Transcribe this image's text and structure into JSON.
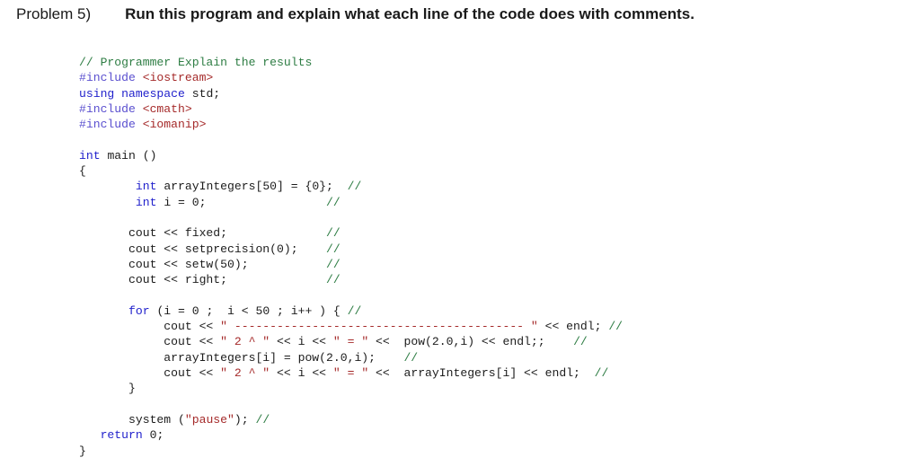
{
  "header": {
    "label": "Problem 5)",
    "text": "Run this program and explain what each line of the code does with comments."
  },
  "colors": {
    "background": "#ffffff",
    "plain": "#1c1c1c",
    "comment": "#2e7d44",
    "keyword": "#2222cc",
    "preprocessor": "#5a4fcf",
    "string": "#a52a2a",
    "header_name": "#a52a2a"
  },
  "code": {
    "language": "C++",
    "lines": [
      {
        "tokens": [
          {
            "t": "// Programmer Explain the results",
            "c": "comment"
          }
        ]
      },
      {
        "tokens": [
          {
            "t": "#include ",
            "c": "pre"
          },
          {
            "t": "<iostream>",
            "c": "header"
          }
        ]
      },
      {
        "tokens": [
          {
            "t": "using namespace ",
            "c": "keyword"
          },
          {
            "t": "std;",
            "c": "plain"
          }
        ]
      },
      {
        "tokens": [
          {
            "t": "#include ",
            "c": "pre"
          },
          {
            "t": "<cmath>",
            "c": "header"
          }
        ]
      },
      {
        "tokens": [
          {
            "t": "#include ",
            "c": "pre"
          },
          {
            "t": "<iomanip>",
            "c": "header"
          }
        ]
      },
      {
        "tokens": []
      },
      {
        "tokens": [
          {
            "t": "int ",
            "c": "keyword"
          },
          {
            "t": "main ()",
            "c": "plain"
          }
        ]
      },
      {
        "tokens": [
          {
            "t": "{",
            "c": "plain"
          }
        ]
      },
      {
        "tokens": [
          {
            "t": "        ",
            "c": "plain"
          },
          {
            "t": "int ",
            "c": "keyword"
          },
          {
            "t": "arrayIntegers[50] = {0};  ",
            "c": "plain"
          },
          {
            "t": "//",
            "c": "comment"
          }
        ]
      },
      {
        "tokens": [
          {
            "t": "        ",
            "c": "plain"
          },
          {
            "t": "int ",
            "c": "keyword"
          },
          {
            "t": "i = 0;",
            "c": "plain"
          },
          {
            "t": "                 ",
            "c": "plain"
          },
          {
            "t": "//",
            "c": "comment"
          }
        ]
      },
      {
        "tokens": []
      },
      {
        "tokens": [
          {
            "t": "       cout << fixed;",
            "c": "plain"
          },
          {
            "t": "              ",
            "c": "plain"
          },
          {
            "t": "//",
            "c": "comment"
          }
        ]
      },
      {
        "tokens": [
          {
            "t": "       cout << setprecision(0);",
            "c": "plain"
          },
          {
            "t": "    ",
            "c": "plain"
          },
          {
            "t": "//",
            "c": "comment"
          }
        ]
      },
      {
        "tokens": [
          {
            "t": "       cout << setw(50);",
            "c": "plain"
          },
          {
            "t": "           ",
            "c": "plain"
          },
          {
            "t": "//",
            "c": "comment"
          }
        ]
      },
      {
        "tokens": [
          {
            "t": "       cout << right;",
            "c": "plain"
          },
          {
            "t": "              ",
            "c": "plain"
          },
          {
            "t": "//",
            "c": "comment"
          }
        ]
      },
      {
        "tokens": []
      },
      {
        "tokens": [
          {
            "t": "       ",
            "c": "plain"
          },
          {
            "t": "for ",
            "c": "keyword"
          },
          {
            "t": "(i = 0 ;  i < 50 ; i++ ) { ",
            "c": "plain"
          },
          {
            "t": "//",
            "c": "comment"
          }
        ]
      },
      {
        "tokens": [
          {
            "t": "            cout << ",
            "c": "plain"
          },
          {
            "t": "\" ----------------------------------------- \"",
            "c": "string"
          },
          {
            "t": " << endl; ",
            "c": "plain"
          },
          {
            "t": "//",
            "c": "comment"
          }
        ]
      },
      {
        "tokens": [
          {
            "t": "            cout << ",
            "c": "plain"
          },
          {
            "t": "\" 2 ^ \"",
            "c": "string"
          },
          {
            "t": " << i << ",
            "c": "plain"
          },
          {
            "t": "\" = \"",
            "c": "string"
          },
          {
            "t": " <<  pow(2.0,i) << endl;;    ",
            "c": "plain"
          },
          {
            "t": "//",
            "c": "comment"
          }
        ]
      },
      {
        "tokens": [
          {
            "t": "            arrayIntegers[i] = pow(2.0,i);    ",
            "c": "plain"
          },
          {
            "t": "//",
            "c": "comment"
          }
        ]
      },
      {
        "tokens": [
          {
            "t": "            cout << ",
            "c": "plain"
          },
          {
            "t": "\" 2 ^ \"",
            "c": "string"
          },
          {
            "t": " << i << ",
            "c": "plain"
          },
          {
            "t": "\" = \"",
            "c": "string"
          },
          {
            "t": " <<  arrayIntegers[i] << endl;  ",
            "c": "plain"
          },
          {
            "t": "//",
            "c": "comment"
          }
        ]
      },
      {
        "tokens": [
          {
            "t": "       }",
            "c": "plain"
          }
        ]
      },
      {
        "tokens": []
      },
      {
        "tokens": [
          {
            "t": "       system (",
            "c": "plain"
          },
          {
            "t": "\"pause\"",
            "c": "string"
          },
          {
            "t": "); ",
            "c": "plain"
          },
          {
            "t": "//",
            "c": "comment"
          }
        ]
      },
      {
        "tokens": [
          {
            "t": "   ",
            "c": "plain"
          },
          {
            "t": "return ",
            "c": "keyword"
          },
          {
            "t": "0;",
            "c": "plain"
          }
        ]
      },
      {
        "tokens": [
          {
            "t": "}",
            "c": "plain"
          }
        ]
      }
    ]
  }
}
